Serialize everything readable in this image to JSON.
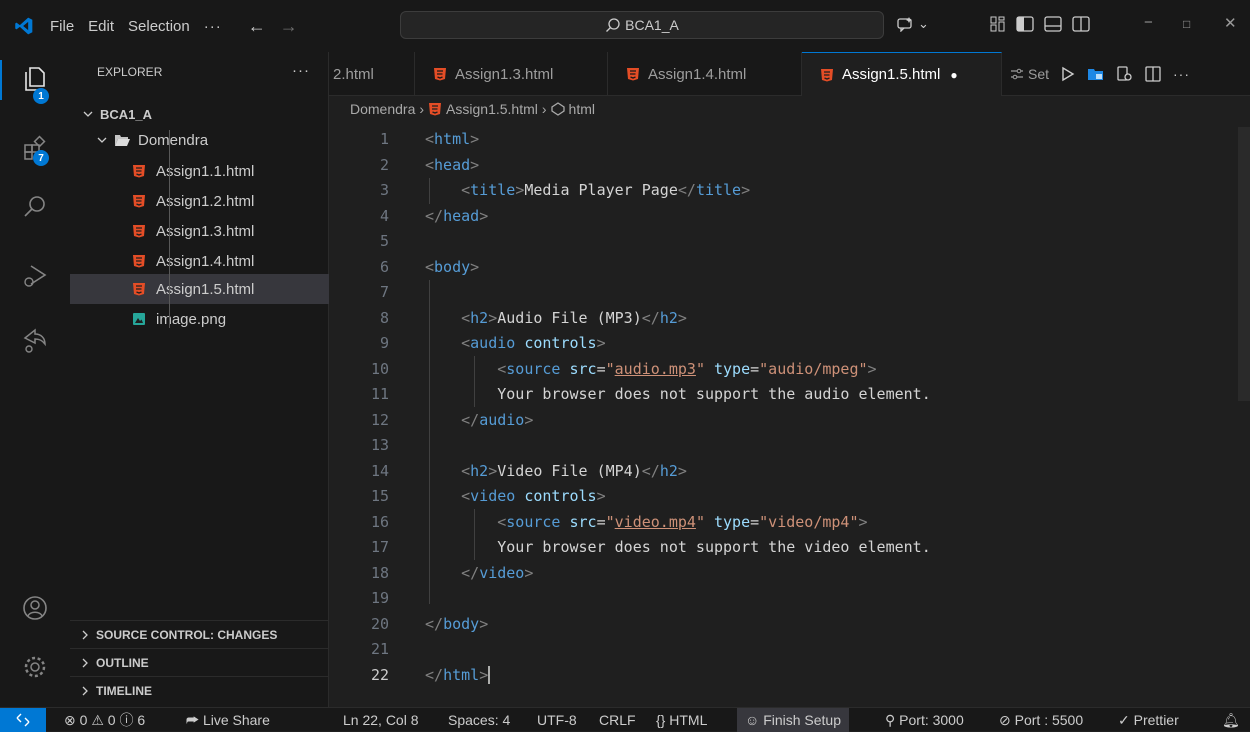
{
  "titlebar": {
    "menu": [
      "File",
      "Edit",
      "Selection"
    ],
    "more": "···",
    "search_text": "BCA1_A"
  },
  "activity_bar": {
    "explorer_badge": "1",
    "extensions_badge": "7"
  },
  "sidebar": {
    "header": "EXPLORER",
    "more": "···",
    "root": "BCA1_A",
    "folder": "Domendra",
    "files": [
      "Assign1.1.html",
      "Assign1.2.html",
      "Assign1.3.html",
      "Assign1.4.html",
      "Assign1.5.html"
    ],
    "image_file": "image.png",
    "sections": [
      "SOURCE CONTROL: CHANGES",
      "OUTLINE",
      "TIMELINE"
    ]
  },
  "tabs": [
    {
      "label": "2.html"
    },
    {
      "label": "Assign1.3.html"
    },
    {
      "label": "Assign1.4.html"
    },
    {
      "label": "Assign1.5.html",
      "active": true,
      "dirty_marker": "●"
    }
  ],
  "tab_actions": {
    "settings_label": "Set"
  },
  "breadcrumb": {
    "folder": "Domendra",
    "file": "Assign1.5.html",
    "symbol": "html"
  },
  "editor": {
    "current_line": 22,
    "line_numbers": [
      "1",
      "2",
      "3",
      "4",
      "5",
      "6",
      "7",
      "8",
      "9",
      "10",
      "11",
      "12",
      "13",
      "14",
      "15",
      "16",
      "17",
      "18",
      "19",
      "20",
      "21",
      "22"
    ]
  },
  "statusbar": {
    "errors": "0",
    "warnings": "0",
    "infos": "6",
    "live_share": "Live Share",
    "position": "Ln 22, Col 8",
    "spaces": "Spaces: 4",
    "encoding": "UTF-8",
    "eol": "CRLF",
    "language": "HTML",
    "finish_setup": "Finish Setup",
    "port_3000": "Port: 3000",
    "port_5500": "Port : 5500",
    "prettier": "Prettier"
  },
  "colors": {
    "accent": "#0078d4",
    "html_icon": "#e44d26",
    "tag": "#569cd6",
    "attr": "#9cdcfe",
    "string": "#ce9178"
  }
}
